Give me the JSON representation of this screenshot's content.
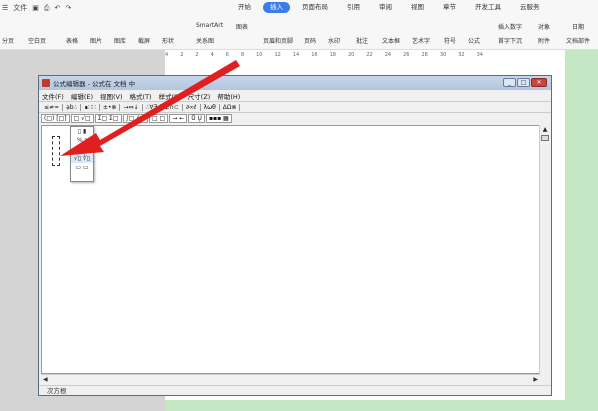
{
  "menubar": {
    "file": "文件",
    "tabs": [
      "开始",
      "插入",
      "页面布局",
      "引用",
      "审阅",
      "视图",
      "章节",
      "开发工具",
      "云服务"
    ],
    "active_tab": "插入"
  },
  "ribbon": {
    "items": [
      "分页",
      "空白页",
      "表格",
      "图片",
      "图库",
      "截屏",
      "形状",
      "SmartArt",
      "图表",
      "关系图",
      "页眉和页脚",
      "页码",
      "水印",
      "批注",
      "文本框",
      "艺术字",
      "符号",
      "公式",
      "插入数字",
      "对象",
      "日期",
      "首字下沉",
      "附件",
      "文档部件"
    ]
  },
  "ruler": [
    "4",
    "2",
    "2",
    "4",
    "6",
    "8",
    "10",
    "12",
    "14",
    "16",
    "18",
    "20",
    "22",
    "24",
    "26",
    "28",
    "30",
    "32",
    "34"
  ],
  "editor": {
    "title": "公式编辑器 - 公式在 文档 中",
    "menu": [
      "文件(F)",
      "编辑(E)",
      "视图(V)",
      "格式(T)",
      "样式(S)",
      "尺寸(Z)",
      "帮助(H)"
    ],
    "palette_row1": [
      "≤≠≈",
      "ạb∴",
      "∎∷∷",
      "±•⊗",
      "→⇔↓",
      "∴∀∃",
      "∉∩⊂",
      "∂∞ℓ",
      "λωθ",
      "ΔΩ⊗"
    ],
    "palette_row2": [
      "(□) [□]",
      "□ √□",
      "Σ□ Σ□",
      "∫□ ∮□",
      "□ □",
      "→ ←",
      "Ů Ų",
      "▪▪▪ ▦"
    ],
    "dropdown": [
      "▯ ▮",
      "% ⁿ",
      "⁽ⁿ⁾",
      "√▯ ∜▯",
      "▭ ▭"
    ],
    "status": "次方根"
  }
}
